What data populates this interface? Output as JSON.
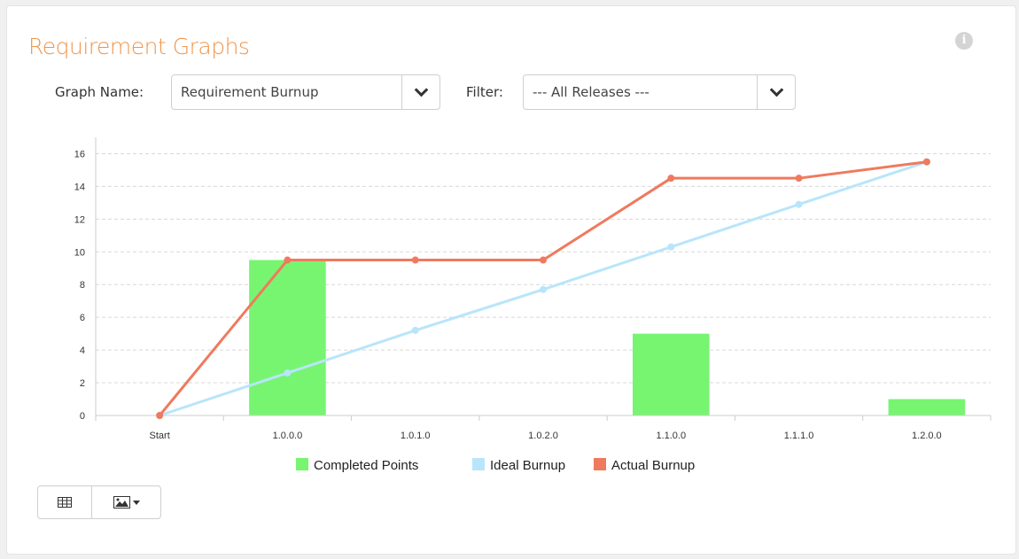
{
  "header": {
    "title": "Requirement Graphs",
    "info_icon": "info-circle-icon"
  },
  "controls": {
    "graph_name_label": "Graph Name:",
    "graph_name_value": "Requirement Burnup",
    "filter_label": "Filter:",
    "filter_value": "--- All Releases ---"
  },
  "toolbar": {
    "table_icon": "table-grid-icon",
    "image_icon": "image-export-icon"
  },
  "colors": {
    "completed": "#77f571",
    "ideal": "#b8e5fb",
    "actual": "#ef7a5e",
    "title": "#f0954a"
  },
  "chart_data": {
    "type": "bar",
    "categories": [
      "Start",
      "1.0.0.0",
      "1.0.1.0",
      "1.0.2.0",
      "1.1.0.0",
      "1.1.1.0",
      "1.2.0.0"
    ],
    "series": [
      {
        "name": "Completed Points",
        "type": "bar",
        "values": [
          0,
          9.5,
          0,
          0,
          5,
          0,
          1
        ]
      },
      {
        "name": "Ideal Burnup",
        "type": "line",
        "values": [
          0,
          2.6,
          5.2,
          7.7,
          10.3,
          12.9,
          15.5
        ]
      },
      {
        "name": "Actual Burnup",
        "type": "line",
        "values": [
          0,
          9.5,
          9.5,
          9.5,
          14.5,
          14.5,
          15.5
        ]
      }
    ],
    "yticks": [
      "0",
      "2",
      "4",
      "6",
      "8",
      "10",
      "12",
      "14",
      "16"
    ],
    "ylim": [
      0,
      17
    ],
    "grid": true,
    "legend": "bottom-center"
  }
}
